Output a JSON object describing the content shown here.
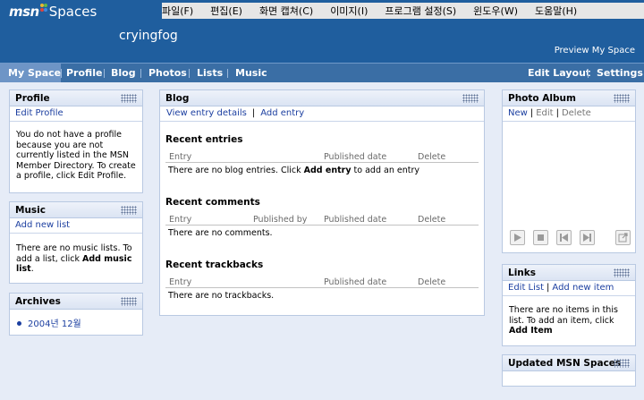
{
  "header": {
    "logo_msn": "msn",
    "logo_spaces": "Spaces",
    "space_title": "cryingfog",
    "preview_link": "Preview My Space"
  },
  "menubar": {
    "items": [
      "파일(F)",
      "편집(E)",
      "화면 캡쳐(C)",
      "이미지(I)",
      "프로그램 설정(S)",
      "윈도우(W)",
      "도움말(H)"
    ]
  },
  "nav": {
    "left": [
      "My Space",
      "Profile",
      "Blog",
      "Photos",
      "Lists",
      "Music"
    ],
    "right": [
      "Edit Layout",
      "Settings"
    ],
    "active": "My Space"
  },
  "profile": {
    "title": "Profile",
    "link": "Edit Profile",
    "text": "You do not have a profile because you are not currently listed in the MSN Member Directory. To create a profile, click Edit Profile."
  },
  "music": {
    "title": "Music",
    "link": "Add new list",
    "text_before": "There are no music lists. To add a list, click ",
    "text_bold": "Add music list",
    "text_after": "."
  },
  "archives": {
    "title": "Archives",
    "items": [
      "2004년 12월"
    ]
  },
  "blog": {
    "title": "Blog",
    "link_view": "View entry details",
    "link_add": "Add entry",
    "recent_entries": {
      "title": "Recent entries",
      "headers": [
        "Entry",
        "Published date",
        "Delete"
      ],
      "empty_before": "There are no blog entries. Click ",
      "empty_bold": "Add entry",
      "empty_after": " to add an entry"
    },
    "recent_comments": {
      "title": "Recent comments",
      "headers": [
        "Entry",
        "Published by",
        "Published date",
        "Delete"
      ],
      "empty": "There are no comments."
    },
    "recent_trackbacks": {
      "title": "Recent trackbacks",
      "headers": [
        "Entry",
        "Published date",
        "Delete"
      ],
      "empty": "There are no trackbacks."
    }
  },
  "photo_album": {
    "title": "Photo Album",
    "links": [
      "New",
      "Edit",
      "Delete"
    ],
    "controls": [
      "play-icon",
      "stop-icon",
      "previous-icon",
      "next-icon",
      "popout-icon"
    ]
  },
  "links": {
    "title": "Links",
    "link_edit": "Edit List",
    "link_add": "Add new item",
    "text_before": "There are no items in this list. To add an item, click ",
    "text_bold": "Add Item"
  },
  "updated": {
    "title": "Updated MSN Spaces"
  },
  "colors": {
    "header_bg": "#1f5e9e",
    "nav_bg": "#3a6ea5",
    "nav_active": "#6e95c6",
    "link": "#1c3fa0",
    "page_bg": "#e6ecf7"
  }
}
